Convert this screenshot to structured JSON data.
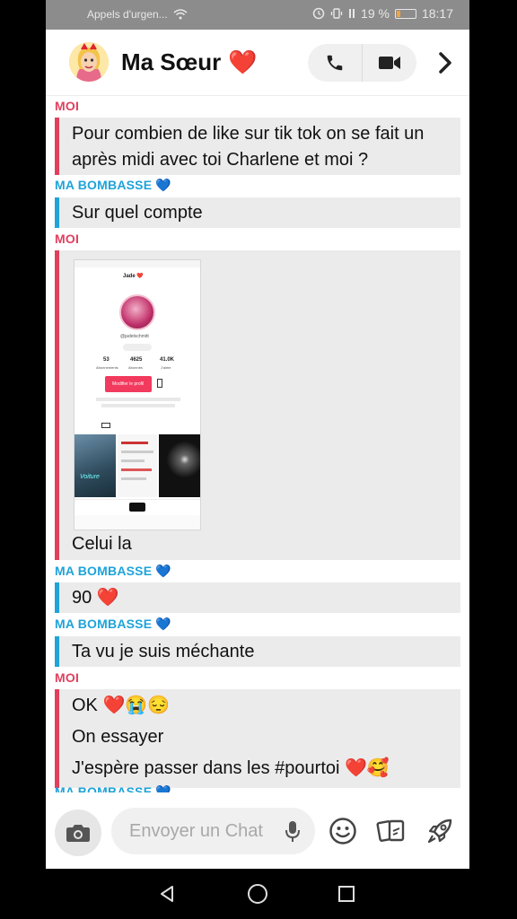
{
  "status_bar": {
    "carrier": "Appels d'urgen...",
    "battery": "19 %",
    "battery_level": 0.19,
    "time": "18:17"
  },
  "header": {
    "title": "Ma Sœur",
    "title_emoji": "❤️",
    "icons": [
      "avatar",
      "phone-icon",
      "video-icon",
      "chevron-right-icon"
    ]
  },
  "messages": [
    {
      "sender": "MOI",
      "lines": [
        "Pour combien de like sur tik tok on se fait un",
        "après midi avec toi Charlene et moi ?"
      ]
    },
    {
      "sender": "MA BOMBASSE 💙",
      "lines": [
        "Sur quel compte"
      ]
    },
    {
      "sender": "MOI",
      "attachment": "screenshot",
      "lines": [
        "Celui la"
      ]
    },
    {
      "sender": "MA BOMBASSE 💙",
      "lines": [
        "90 ❤️"
      ]
    },
    {
      "sender": "MA BOMBASSE 💙",
      "lines": [
        "Ta vu je suis méchante"
      ]
    },
    {
      "sender": "MOI",
      "lines": [
        "OK ❤️😭😔",
        "On essayer",
        "J'espère passer dans les #pourtoi ❤️🥰"
      ]
    },
    {
      "sender": "MA BOMBASSE 💙",
      "lines": []
    }
  ],
  "embedded_screenshot": {
    "profile_name": "Jade ❤️",
    "handle": "@jadetschmitt",
    "stats": [
      {
        "value": "53",
        "label": "Abonnements"
      },
      {
        "value": "4625",
        "label": "Abonnés"
      },
      {
        "value": "41.0K",
        "label": "J'aime"
      }
    ],
    "edit_button": "Modifier le profil",
    "video_caption": "Voiture"
  },
  "input": {
    "placeholder": "Envoyer un Chat"
  },
  "colors": {
    "me": "#e0405e",
    "her": "#1fa3d9",
    "bubble": "#ebebeb"
  }
}
